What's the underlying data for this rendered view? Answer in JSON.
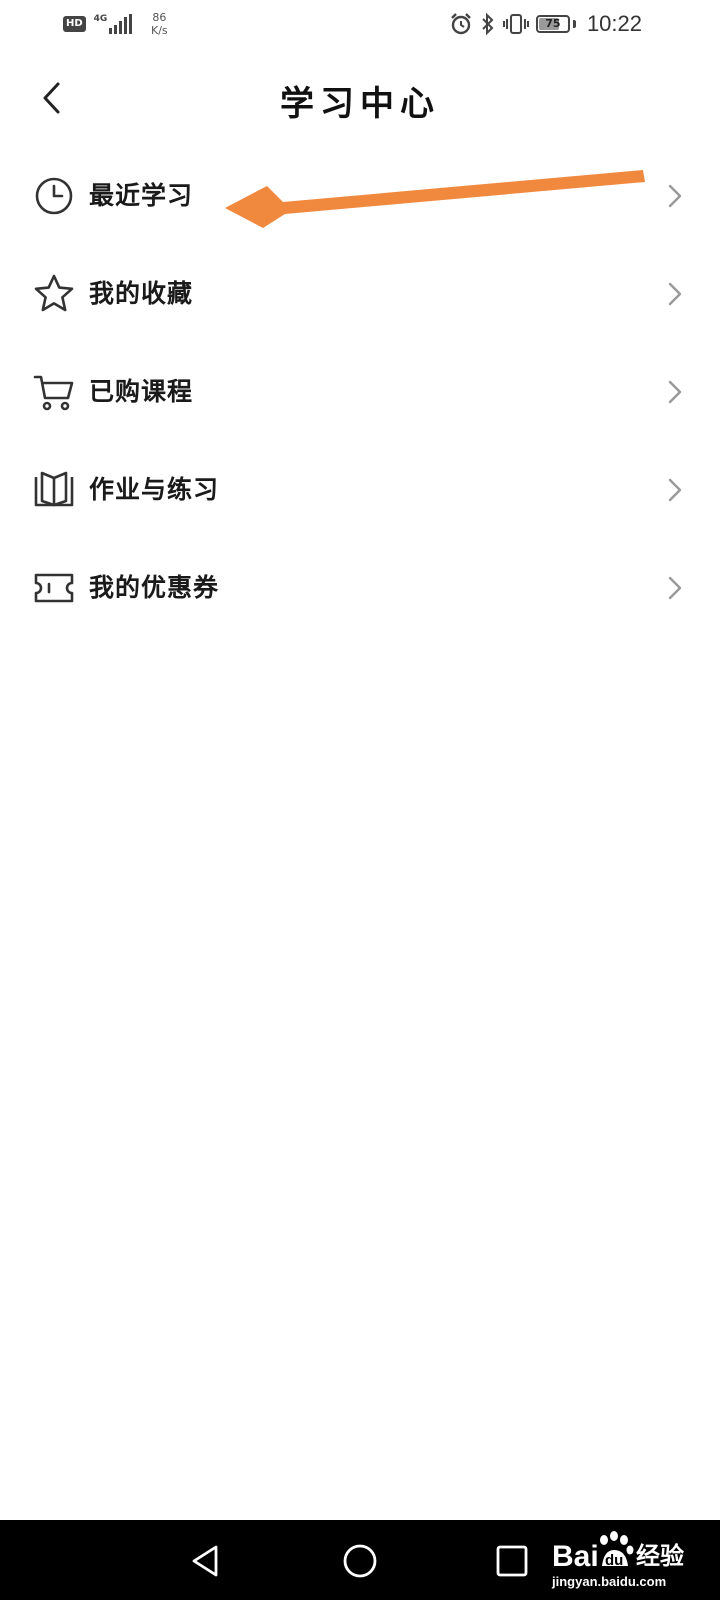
{
  "status_bar": {
    "hd": "HD",
    "network_type": "4G",
    "speed_value": "86",
    "speed_unit": "K/s",
    "battery": "75",
    "battery_fraction": 0.75,
    "time": "10:22"
  },
  "header": {
    "title": "学习中心",
    "back_icon": "chevron-left-icon"
  },
  "menu": {
    "items": [
      {
        "icon": "clock-icon",
        "label": "最近学习"
      },
      {
        "icon": "star-icon",
        "label": "我的收藏"
      },
      {
        "icon": "cart-icon",
        "label": "已购课程"
      },
      {
        "icon": "book-icon",
        "label": "作业与练习"
      },
      {
        "icon": "ticket-icon",
        "label": "我的优惠券"
      }
    ]
  },
  "annotation": {
    "arrow_color": "#f0883e"
  },
  "nav_bar": {
    "back": "triangle-back-icon",
    "home": "circle-home-icon",
    "recents": "square-recents-icon"
  },
  "watermark": {
    "logo_text": "Bai",
    "logo_text2": "du",
    "cn_text": "经验",
    "url": "jingyan.baidu.com"
  }
}
